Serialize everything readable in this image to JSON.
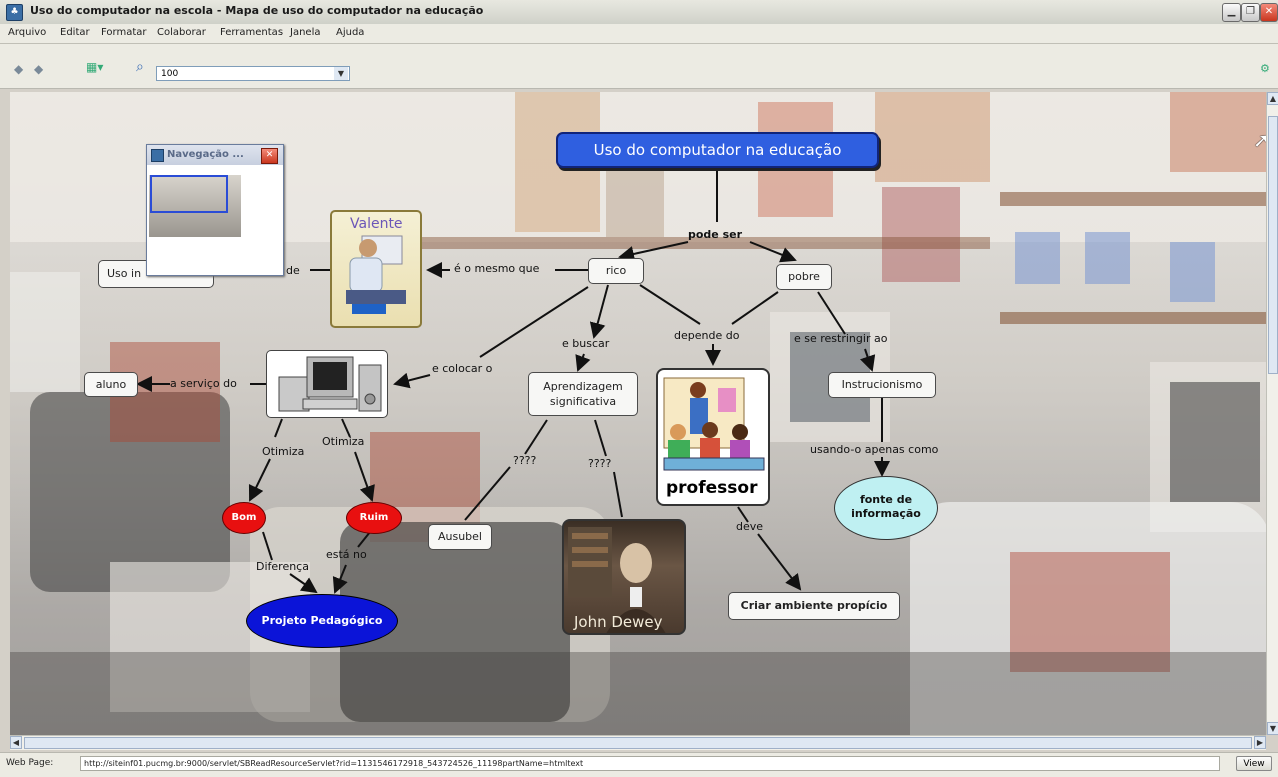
{
  "window": {
    "title": "Uso do computador na escola - Mapa de uso do computador na educação",
    "app_icon": "cmaptools-icon",
    "buttons": [
      "minimize-icon",
      "restore-icon",
      "close-icon"
    ]
  },
  "menubar": {
    "items": [
      "Arquivo",
      "Editar",
      "Formatar",
      "Colaborar",
      "Ferramentas",
      "Janela",
      "Ajuda"
    ]
  },
  "toolbar": {
    "zoom_value": "100"
  },
  "navigator": {
    "title": "Navegação ..."
  },
  "concept_map": {
    "root": "Uso do computador na educação",
    "nodes": {
      "rico": "rico",
      "pobre": "pobre",
      "aluno": "aluno",
      "uso_in": "Uso in",
      "aprendizagem": "Aprendizagem significativa",
      "instrucionismo": "Instrucionismo",
      "ausubel": "Ausubel",
      "criar": "Criar ambiente propício",
      "bom": "Bom",
      "ruim": "Ruim",
      "projeto": "Projeto Pedagógico",
      "fonte": "fonte de informação",
      "valente": "Valente",
      "professor": "professor",
      "dewey": "John Dewey"
    },
    "links": {
      "pode_ser": "pode ser",
      "de": "de",
      "mesmo_que": "é o mesmo que",
      "buscar": "e buscar",
      "depende": "depende do",
      "restringir": "e se restringir ao",
      "colocar": "e colocar o",
      "servico": "a serviço do",
      "otimiza1": "Otimiza",
      "otimiza2": "Otimiza",
      "q1": "????",
      "q2": "????",
      "usando": "usando-o apenas como",
      "deve": "deve",
      "diferenca": "Diferença",
      "esta_no": "está no"
    },
    "colors": {
      "root_bg": "#2f5fe0",
      "bom_ruim": "#e81010",
      "projeto": "#0b14d8",
      "fonte": "#bff0f2"
    }
  },
  "statusbar": {
    "label": "Web Page:",
    "url": "http://siteinf01.pucmg.br:9000/servlet/SBReadResourceServlet?rid=1131546172918_543724526_11198partName=htmltext",
    "view_button": "View"
  }
}
